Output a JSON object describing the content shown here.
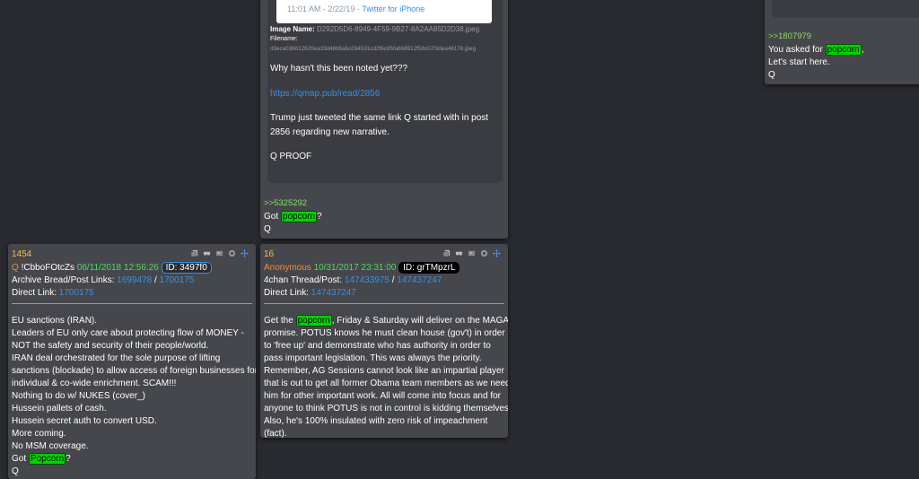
{
  "top_card": {
    "tweet_meta": "11:01 AM - 2/22/19 · ",
    "tweet_source": "Twitter for iPhone",
    "image_name_label": "Image Name:",
    "image_name_value": "D292D5D6-8949-4F59-9B27-8A2AA85D2D38.jpeg",
    "filename_label": "Filename:",
    "filename_value": "d3eca036612620ea33d48b5a5c034531cd2f6c85fa668912f58c07f3dea46176.jpeg",
    "line1": "Why hasn't this been noted yet???",
    "link": "https://qmap.pub/read/2856",
    "para_line1": "Trump just tweeted the same link Q started with in post",
    "para_line2": "2856 regarding new narrative.",
    "proof": "Q PROOF",
    "quote_ref": ">>5325292",
    "got": "Got ",
    "popcorn": "popcorn",
    "qmark": "?",
    "sig": "Q"
  },
  "right_card": {
    "quote_ref": ">>1807979",
    "you_asked": "You asked for ",
    "popcorn": "popcorn",
    "comma": ",",
    "start_here": "Let's start here.",
    "sig": "Q"
  },
  "left_card": {
    "number": "1454",
    "q": "Q",
    "trip": "!CbboFOtcZs",
    "date": "06/11/2018 12:56:26",
    "id_badge": "ID: 3497f0",
    "archive_label": "Archive Bread/Post Links:",
    "archive_link1": "1699478",
    "slash": " / ",
    "archive_link2": "1700175",
    "direct_label": "Direct Link:",
    "direct_link": "1700175",
    "lines": [
      "EU sanctions (IRAN).",
      "Leaders of EU only care about protecting flow of MONEY -",
      "NOT the safety and security of their people/world.",
      "IRAN deal orchestrated for the sole purpose of lifting",
      "sanctions (blockade) to allow access of foreign businesses for",
      "individual & co-wide enrichment. SCAM!!!",
      "Nothing to do w/ NUKES (cover_)",
      "Hussein pallets of cash.",
      "Hussein secret auth to convert USD.",
      "More coming.",
      "No MSM coverage."
    ],
    "got": "Got ",
    "popcorn": "Popcorn",
    "qmark": "?",
    "sig": "Q"
  },
  "mid_card": {
    "number": "16",
    "anon": "Anonymous",
    "date": "10/31/2017 23:31:00",
    "id_badge": "ID: grTMpzrL",
    "thread_label": "4chan Thread/Post:",
    "thread_link1": "147433975",
    "slash": " / ",
    "thread_link2": "147437247",
    "direct_label": "Direct Link:",
    "direct_link": "147437247",
    "get_the": "Get the ",
    "popcorn": "popcorn",
    "line1_rest": ", Friday & Saturday will deliver on the MAGA",
    "lines": [
      "promise. POTUS knows he must clean house (gov't) in order",
      "to 'free up' and demonstrate who has authority in order to",
      "pass important legislation. This was always the priority.",
      "Remember, AG Sessions cannot look like an impartial player",
      "that is out to get all former Obama team members as we need",
      "him for other important work. All will come into focus and for",
      "anyone to think POTUS is not in control is kidding themselves.",
      "Also, he's 100% insulated with zero risk of impeachment",
      "(fact)."
    ]
  }
}
